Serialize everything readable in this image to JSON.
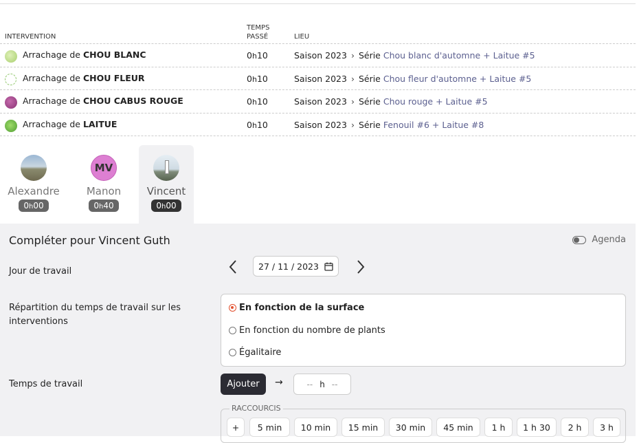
{
  "table": {
    "headers": {
      "intervention": "INTERVENTION",
      "temps_line1": "TEMPS",
      "temps_line2": "PASSÉ",
      "lieu": "LIEU"
    },
    "rows": [
      {
        "prefix": "Arrachage de",
        "crop": "CHOU BLANC",
        "h": "0",
        "m": "10",
        "h_unit": "h",
        "saison": "Saison 2023",
        "serie_label": "Série",
        "serie": "Chou blanc d'automne + Laitue #5",
        "icon": "cabbage-white-icon",
        "color": "#b9d98a"
      },
      {
        "prefix": "Arrachage de",
        "crop": "CHOU FLEUR",
        "h": "0",
        "m": "10",
        "h_unit": "h",
        "saison": "Saison 2023",
        "serie_label": "Série",
        "serie": "Chou fleur d'automne + Laitue #5",
        "icon": "cauliflower-icon",
        "color": "#9bcf77"
      },
      {
        "prefix": "Arrachage de",
        "crop": "CHOU CABUS ROUGE",
        "h": "0",
        "m": "10",
        "h_unit": "h",
        "saison": "Saison 2023",
        "serie_label": "Série",
        "serie": "Chou rouge + Laitue #5",
        "icon": "red-cabbage-icon",
        "color": "#a64d8f"
      },
      {
        "prefix": "Arrachage de",
        "crop": "LAITUE",
        "h": "0",
        "m": "10",
        "h_unit": "h",
        "saison": "Saison 2023",
        "serie_label": "Série",
        "serie": "Fenouil #6 + Laitue #8",
        "icon": "lettuce-icon",
        "color": "#6fbf4a"
      }
    ]
  },
  "users": [
    {
      "name": "Alexandre",
      "h": "0",
      "m": "00",
      "h_unit": "h",
      "avatar": "landscape-photo"
    },
    {
      "name": "Manon",
      "h": "0",
      "m": "40",
      "h_unit": "h",
      "initials": "MV",
      "avatar_color": "#dd7fd2"
    },
    {
      "name": "Vincent",
      "h": "0",
      "m": "00",
      "h_unit": "h",
      "avatar": "lighthouse-photo",
      "selected": true
    }
  ],
  "panel": {
    "title": "Compléter pour Vincent Guth",
    "agenda_label": "Agenda",
    "workday_label": "Jour de travail",
    "date_value": "27 / 11 / 2023",
    "repartition_label": "Répartition du temps de travail sur les interventions",
    "options": [
      "En fonction de la surface",
      "En fonction du nombre de plants",
      "Égalitaire"
    ],
    "selected_option": 0,
    "worktime_label": "Temps de travail",
    "add_button": "Ajouter",
    "arrow": "→",
    "hours_placeholder": "--",
    "h_unit": "h",
    "minutes_placeholder": "--",
    "shortcuts_label": "RACCOURCIS",
    "shortcuts": [
      "+",
      "5 min",
      "10 min",
      "15 min",
      "30 min",
      "45 min",
      "1 h",
      "1 h 30",
      "2 h",
      "3 h"
    ],
    "accent_color": "#e2502e"
  }
}
